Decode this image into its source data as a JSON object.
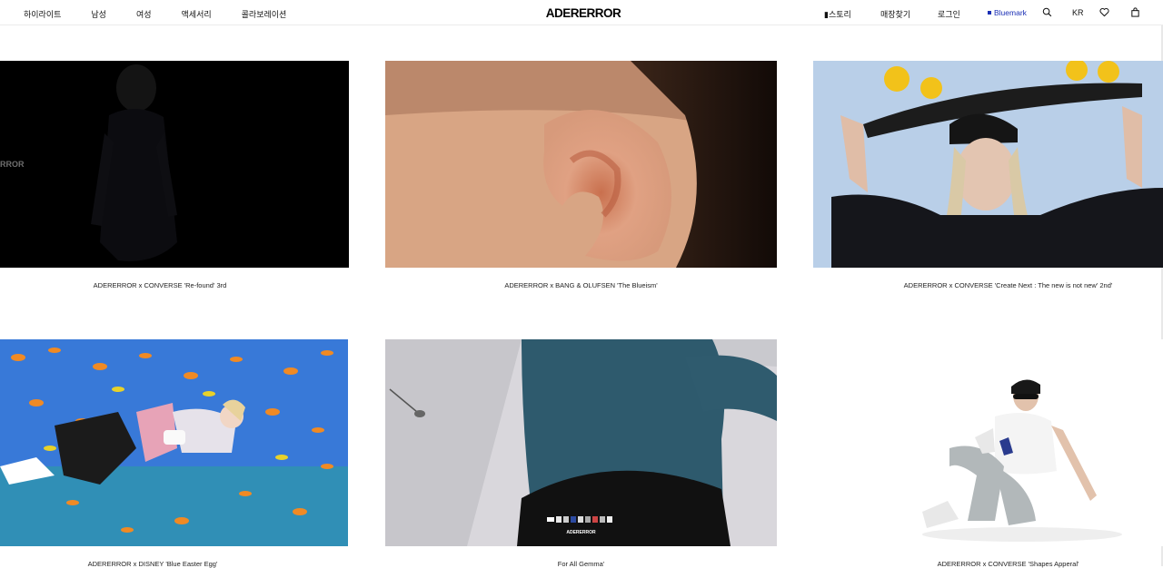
{
  "header": {
    "nav_left": [
      "하이라이트",
      "남성",
      "여성",
      "액세서리",
      "콜라보레이션"
    ],
    "logo": "ADERERROR",
    "story": "▮스토리",
    "store": "매장찾기",
    "login": "로그인",
    "bluemark": "Bluemark",
    "lang": "KR",
    "icons": [
      "search-icon",
      "heart-icon",
      "bag-icon"
    ]
  },
  "cards": [
    {
      "caption": "ADERERROR x CONVERSE 'Re-found' 3rd",
      "overlay_text": "RROR"
    },
    {
      "caption": "ADERERROR x BANG & OLUFSEN 'The Blueism'"
    },
    {
      "caption": "ADERERROR x CONVERSE 'Create Next : The new is not new' 2nd'"
    },
    {
      "caption": "ADERERROR x DISNEY 'Blue Easter Egg'"
    },
    {
      "caption": "For All Gemma'",
      "overlay_text": "ADERERROR"
    },
    {
      "caption": "ADERERROR x CONVERSE 'Shapes Apperal'"
    }
  ]
}
